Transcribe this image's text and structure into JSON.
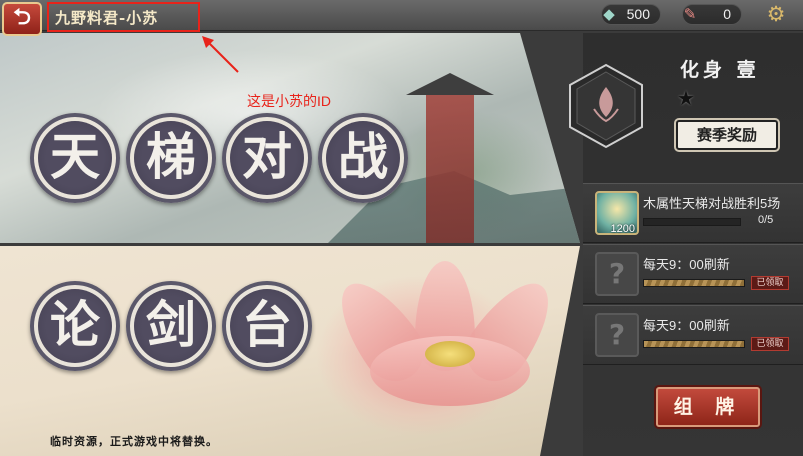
{
  "topbar": {
    "back_icon": "back-arrow-icon",
    "player_title": "九野料君-小苏",
    "currencies": [
      {
        "icon": "jade-icon",
        "value": "500"
      },
      {
        "icon": "feather-icon",
        "value": "0"
      }
    ],
    "settings_icon": "gear-icon"
  },
  "annotation": {
    "text": "这是小苏的ID",
    "color": "#e8231a"
  },
  "modes": [
    {
      "chars": [
        "天",
        "梯",
        "对",
        "战"
      ]
    },
    {
      "chars": [
        "论",
        "剑",
        "台"
      ]
    }
  ],
  "notice": "临时资源，正式游戏中将替换。",
  "profile": {
    "avatar_name": "化身 壹",
    "star_icon": "star-icon",
    "season_reward_label": "赛季奖励"
  },
  "tasks": [
    {
      "label": "木属性天梯对战胜利5场",
      "progress": "0/5",
      "reward_qty": "1200",
      "progress_fraction": 0
    },
    {
      "label": "每天9：00刷新",
      "status": "已领取",
      "progress_fraction": 1
    },
    {
      "label": "每天9：00刷新",
      "status": "已领取",
      "progress_fraction": 1
    }
  ],
  "deck_button_label": "组 牌",
  "colors": {
    "accent_red": "#8e2519",
    "annotation_red": "#e8231a",
    "badge_dark": "#514c60"
  }
}
